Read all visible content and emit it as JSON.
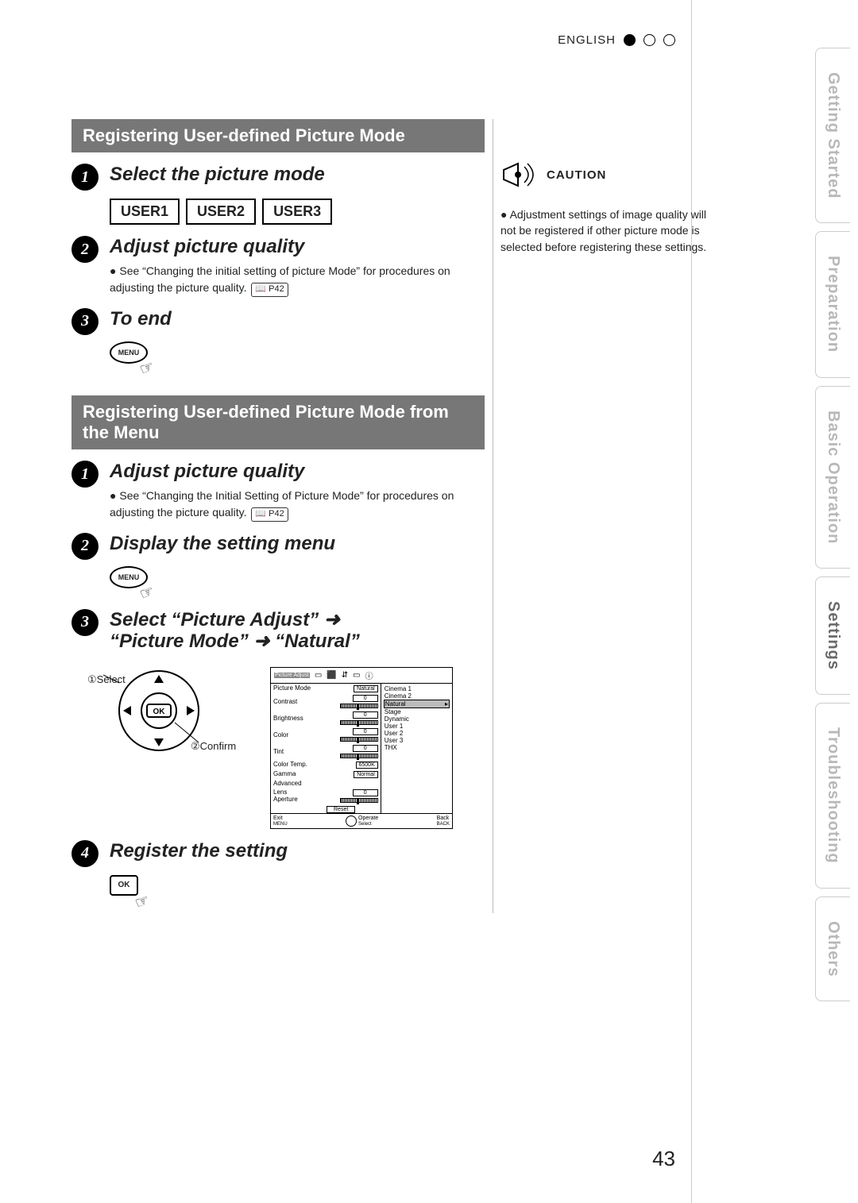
{
  "language": "ENGLISH",
  "page_number": "43",
  "tabs": [
    "Getting Started",
    "Preparation",
    "Basic Operation",
    "Settings",
    "Troubleshooting",
    "Others"
  ],
  "active_tab_index": 3,
  "sectionA": {
    "title": "Registering User-defined Picture Mode",
    "step1": {
      "title": "Select the picture mode",
      "buttons": [
        "USER1",
        "USER2",
        "USER3"
      ]
    },
    "step2": {
      "title": "Adjust picture quality",
      "note": "See “Changing the initial setting of picture Mode” for procedures on adjusting the picture quality.",
      "page_ref": "P42"
    },
    "step3": {
      "title": "To end",
      "menu_label": "MENU"
    }
  },
  "sectionB": {
    "title": "Registering User-defined Picture Mode from the Menu",
    "step1": {
      "title": "Adjust picture quality",
      "note": "See “Changing the Initial Setting of Picture Mode” for procedures on adjusting the picture quality.",
      "page_ref": "P42"
    },
    "step2": {
      "title": "Display the setting menu",
      "menu_label": "MENU"
    },
    "step3": {
      "line1": "Select “Picture Adjust” ➜",
      "line2": "“Picture Mode” ➜ “Natural”",
      "remote_sel": "①Select",
      "remote_ok": "②Confirm",
      "ok_label": "OK"
    },
    "step4": {
      "title": "Register the setting",
      "ok_label": "OK"
    }
  },
  "osd": {
    "tab": "Picture Adjust",
    "rows": [
      {
        "label": "Picture Mode",
        "val": "Natural",
        "pill": true
      },
      {
        "label": "Contrast",
        "val": "0",
        "slider": true
      },
      {
        "label": "Brightness",
        "val": "0",
        "slider": true
      },
      {
        "label": "Color",
        "val": "0",
        "slider": true
      },
      {
        "label": "Tint",
        "val": "0",
        "slider": true
      },
      {
        "label": "Color Temp.",
        "val": "6500K",
        "pill": true
      },
      {
        "label": "Gamma",
        "val": "Normal",
        "pill": true
      },
      {
        "label": "Advanced"
      },
      {
        "label": "Lens Aperture",
        "val": "0",
        "slider": true
      }
    ],
    "reset": "Reset",
    "options": [
      "Cinema 1",
      "Cinema 2",
      "Natural",
      "Stage",
      "Dynamic",
      "User 1",
      "User 2",
      "User 3",
      "THX"
    ],
    "highlight": "Natural",
    "bottom": {
      "exit": "Exit",
      "exit_sub": "MENU",
      "op": "Operate",
      "sel": "Select",
      "back": "Back",
      "back_sub": "BACK"
    }
  },
  "caution": {
    "heading": "CAUTION",
    "text": "Adjustment settings of image quality will not be registered if other picture mode is selected before registering these settings."
  }
}
